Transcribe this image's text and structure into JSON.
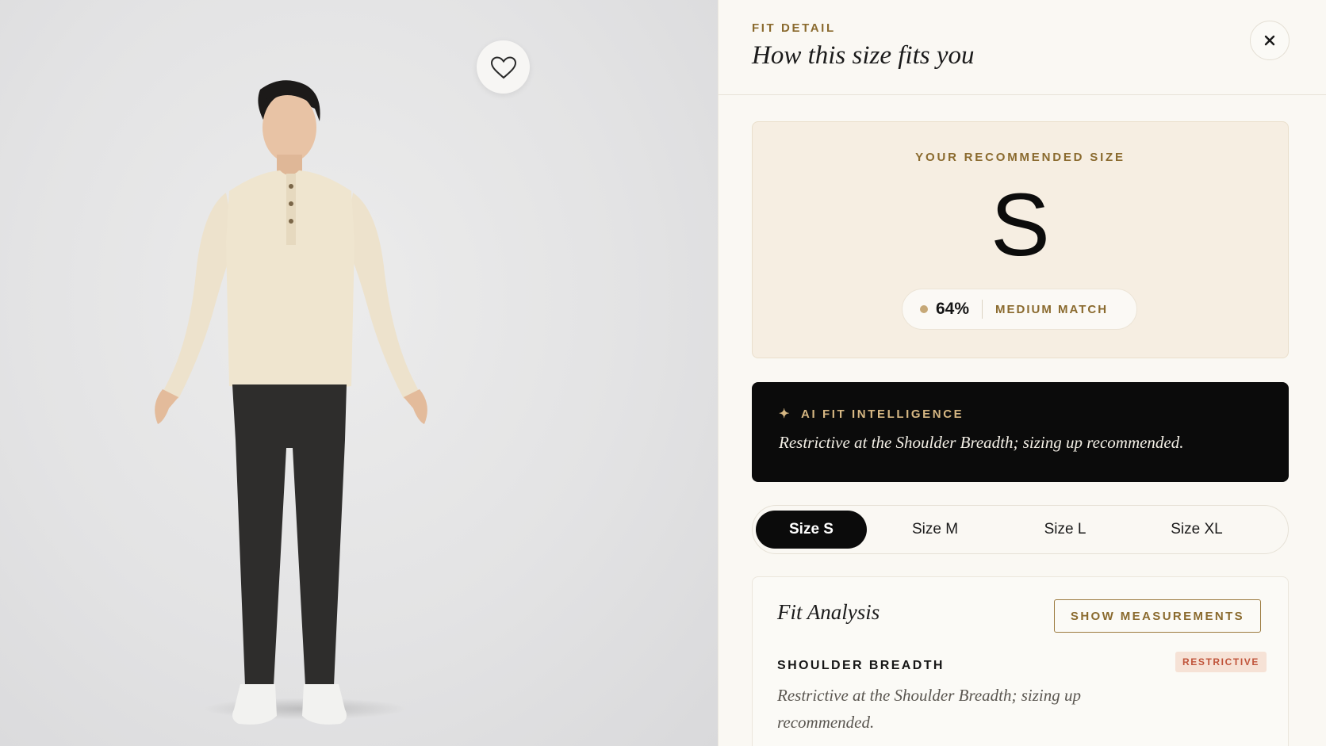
{
  "photo": {
    "wishlist_icon": "heart-outline-icon"
  },
  "panel": {
    "eyebrow": "FIT DETAIL",
    "title": "How this size fits you",
    "close_icon": "close-icon"
  },
  "recommendation": {
    "label": "YOUR RECOMMENDED SIZE",
    "size": "S",
    "match_percent": "64%",
    "match_label": "MEDIUM MATCH"
  },
  "ai_fit": {
    "label": "AI FIT INTELLIGENCE",
    "icon": "sparkle-icon",
    "message": "Restrictive at the Shoulder Breadth; sizing up recommended."
  },
  "size_tabs": [
    {
      "label": "Size S",
      "active": true
    },
    {
      "label": "Size M",
      "active": false
    },
    {
      "label": "Size L",
      "active": false
    },
    {
      "label": "Size XL",
      "active": false
    }
  ],
  "fit_analysis": {
    "title": "Fit Analysis",
    "show_measurements_label": "SHOW MEASUREMENTS",
    "metrics": [
      {
        "name": "SHOULDER BREADTH",
        "status": "RESTRICTIVE",
        "description": "Restrictive at the Shoulder Breadth; sizing up recommended."
      }
    ]
  },
  "colors": {
    "accent_gold": "#8a6a2e",
    "panel_bg": "#faf8f3",
    "card_bg": "#f6eee2",
    "dark": "#0b0b0b",
    "restrictive_red": "#c0543a"
  }
}
